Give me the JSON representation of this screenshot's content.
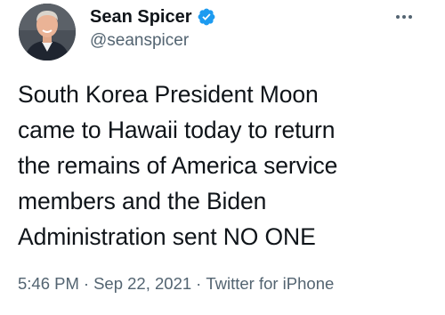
{
  "author": {
    "display_name": "Sean Spicer",
    "handle": "@seanspicer",
    "verified_icon": "verified-badge-icon",
    "accent_color": "#1d9bf0"
  },
  "tweet": {
    "text": "South Korea President Moon\ncame to Hawaii today to return\nthe remains of America service\nmembers and the Biden\nAdministration sent NO ONE"
  },
  "meta": {
    "time": "5:46 PM",
    "separator": "·",
    "date": "Sep 22, 2021",
    "source": "Twitter for iPhone"
  },
  "icons": {
    "more": "more-options-icon"
  }
}
